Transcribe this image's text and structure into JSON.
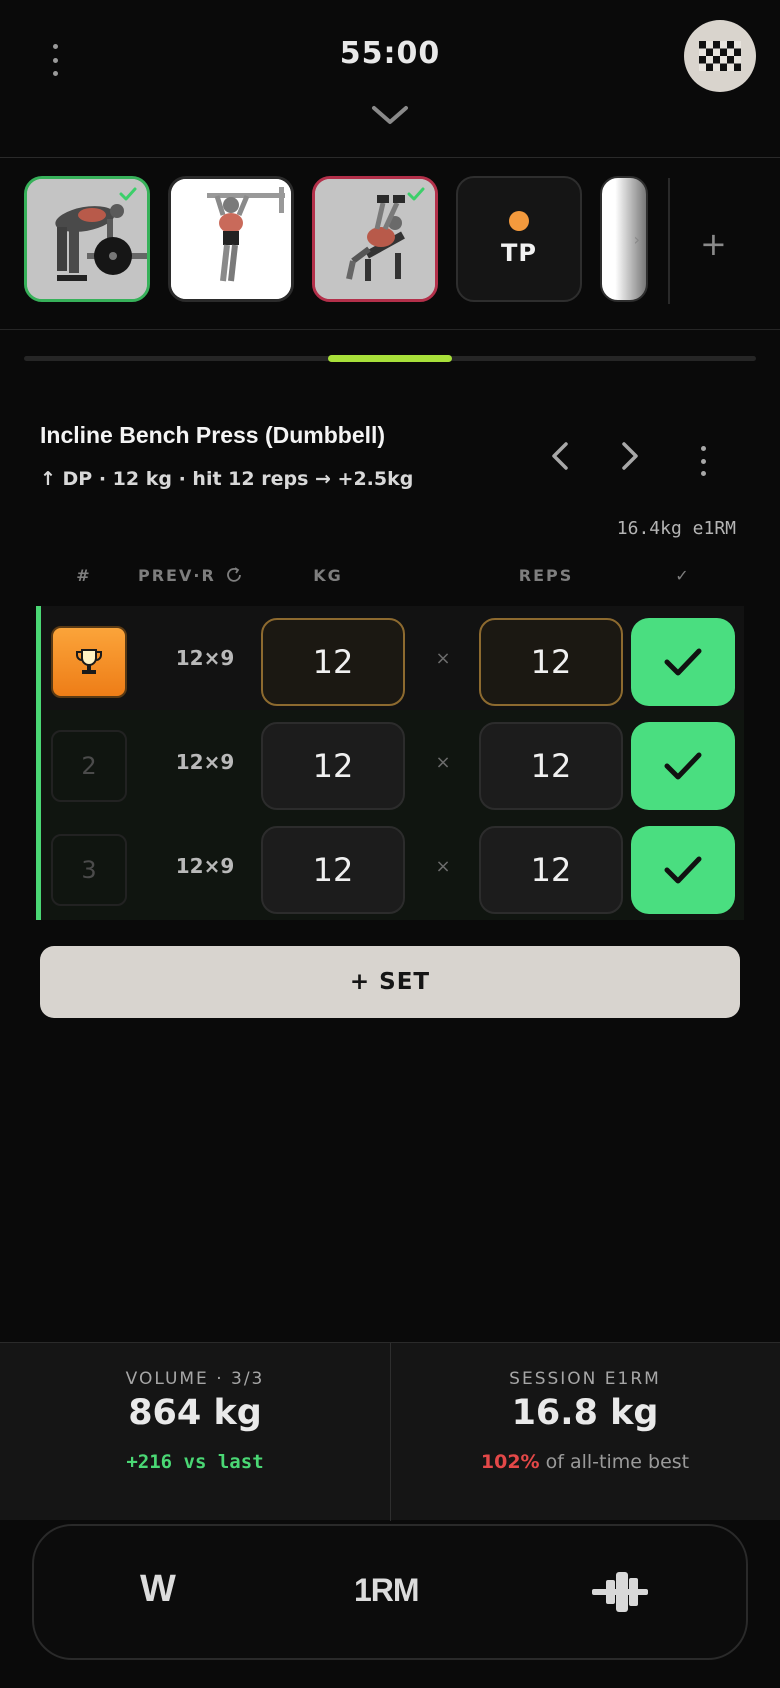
{
  "header": {
    "timer": "55:00"
  },
  "strip": {
    "tp_label": "TP",
    "add_label": "+"
  },
  "exercise": {
    "title": "Incline Bench Press (Dumbbell)",
    "subtitle": "↑ DP · 12 kg · hit 12 reps → +2.5kg",
    "e1rm_tag": "16.4kg e1RM"
  },
  "table": {
    "headers": {
      "num": "#",
      "prev": "PREV·R",
      "kg": "KG",
      "reps": "REPS",
      "done": "✓"
    },
    "times": "×",
    "rows": [
      {
        "num": "",
        "prev": "12×9",
        "kg": "12",
        "reps": "12"
      },
      {
        "num": "2",
        "prev": "12×9",
        "kg": "12",
        "reps": "12"
      },
      {
        "num": "3",
        "prev": "12×9",
        "kg": "12",
        "reps": "12"
      }
    ]
  },
  "add_set_label": "+ SET",
  "stats": {
    "volume_label": "VOLUME  ·  3/3",
    "volume_value": "864 kg",
    "volume_sub": "+216 vs last",
    "e1rm_label": "SESSION E1RM",
    "e1rm_value": "16.8 kg",
    "e1rm_pct": "102%",
    "e1rm_sub": " of all-time best"
  },
  "bottom_bar": {
    "w_label": "W",
    "rm_label": "1RM"
  },
  "colors": {
    "accent_green": "#4ade80",
    "progress_lime": "#a8e03a",
    "current_border": "#b3304a",
    "trophy_orange": "#f39a3d",
    "danger_red": "#e34848"
  }
}
